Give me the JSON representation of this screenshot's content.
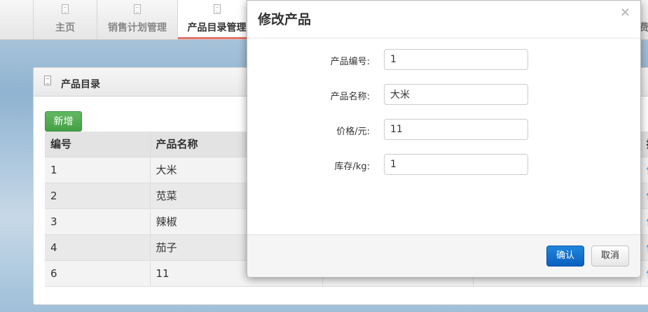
{
  "nav": {
    "tabs": [
      {
        "label": "主页"
      },
      {
        "label": "销售计划管理"
      },
      {
        "label": "产品目录管理"
      }
    ],
    "right_partial": "费"
  },
  "panel": {
    "title": "产品目录",
    "add_label": "新增",
    "columns": [
      "编号",
      "产品名称",
      "",
      "",
      "操"
    ],
    "rows": [
      {
        "id": "1",
        "name": "大米",
        "op": "修"
      },
      {
        "id": "2",
        "name": "苋菜",
        "op": "修"
      },
      {
        "id": "3",
        "name": "辣椒",
        "op": "修"
      },
      {
        "id": "4",
        "name": "茄子",
        "op": "修"
      },
      {
        "id": "6",
        "name": "11",
        "op": "修"
      }
    ]
  },
  "modal": {
    "title": "修改产品",
    "close": "×",
    "fields": [
      {
        "label": "产品编号:",
        "value": "1"
      },
      {
        "label": "产品名称:",
        "value": "大米"
      },
      {
        "label": "价格/元:",
        "value": "11"
      },
      {
        "label": "库存/kg:",
        "value": "1"
      }
    ],
    "ok_label": "确认",
    "cancel_label": "取消"
  },
  "colors": {
    "active_tab_underline": "#e57368",
    "add_button": "#4cae4c",
    "confirm_button": "#0f6ecd",
    "link": "#3a8fd1"
  }
}
